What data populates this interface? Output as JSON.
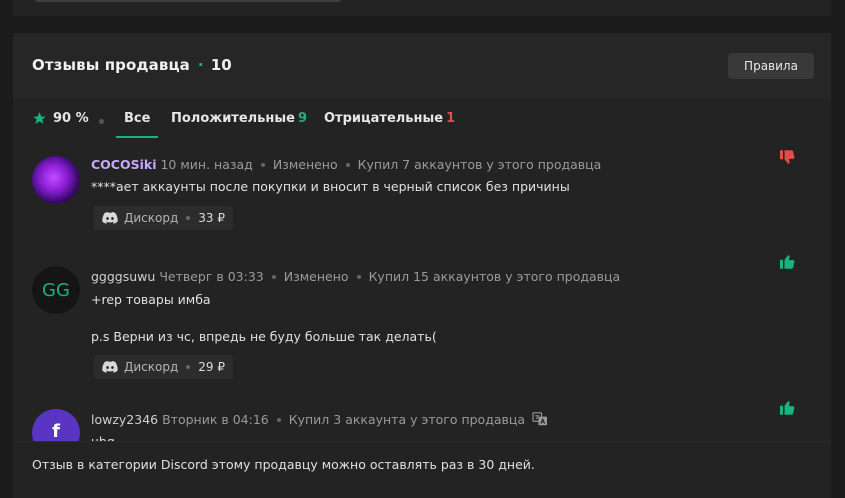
{
  "header": {
    "title": "Отзывы продавца",
    "separator": "·",
    "count": "10",
    "rules_label": "Правила"
  },
  "tabs": {
    "rating": "90 %",
    "all": "Все",
    "positive_label": "Положительные",
    "positive_count": "9",
    "negative_label": "Отрицательные",
    "negative_count": "1"
  },
  "reviews": [
    {
      "username": "COCOSiki",
      "time": "10 мин. назад",
      "edited": "Изменено",
      "purchase": "Купил 7 аккаунтов у этого продавца",
      "text": "****ает аккаунты после покупки и вносит в черный список без причины",
      "category": "Дискорд",
      "price": "33 ₽",
      "sentiment": "negative"
    },
    {
      "username": "ggggsuwu",
      "avatar_text": "GG",
      "time": "Четверг в 03:33",
      "edited": "Изменено",
      "purchase": "Купил 15 аккаунтов у этого продавца",
      "text_line1": "+rep товары имба",
      "text_line2": "p.s Верни из чс, впредь не буду больше так делать(",
      "category": "Дискорд",
      "price": "29 ₽",
      "sentiment": "positive"
    },
    {
      "username": "lowzy2346",
      "avatar_text": "f",
      "time": "Вторник в 04:16",
      "purchase": "Купил 3 аккаунта у этого продавца",
      "text": "ubg",
      "sentiment": "positive"
    }
  ],
  "footer": {
    "notice": "Отзыв в категории Discord этому продавцу можно оставлять раз в 30 дней."
  },
  "colors": {
    "accent": "#19b380",
    "negative": "#e24c4c",
    "vip_name": "#c9a8ff"
  },
  "icons": {
    "rating": "star-icon",
    "category": "discord-icon",
    "positive": "thumbs-up-icon",
    "negative": "thumbs-down-icon",
    "translate": "translate-icon"
  }
}
